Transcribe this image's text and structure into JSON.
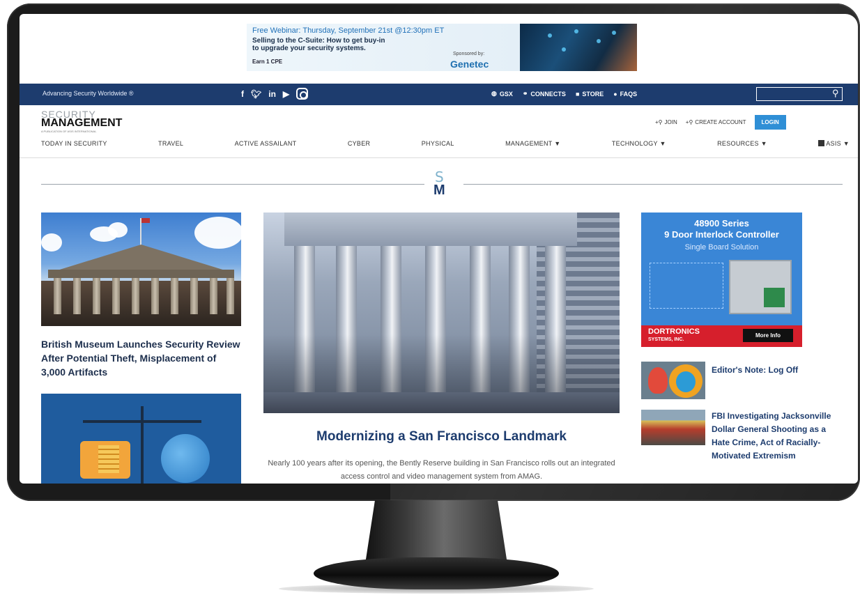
{
  "ad_banner": {
    "headline": "Free Webinar: Thursday, September 21st @12:30pm ET",
    "line1": "Selling to the C-Suite: How to get buy-in",
    "line2": "to upgrade your security systems.",
    "earn": "Earn 1 CPE",
    "sponsored_by": "Sponsored by:",
    "sponsor": "Genetec"
  },
  "topbar": {
    "tagline": "Advancing Security Worldwide ®",
    "social": [
      "f",
      "y",
      "in"
    ],
    "links": [
      {
        "icon": "globe-icon",
        "glyph": "◍",
        "label": "GSX"
      },
      {
        "icon": "people-icon",
        "glyph": "⚭",
        "label": "CONNECTS"
      },
      {
        "icon": "cart-icon",
        "glyph": "■",
        "label": "STORE"
      },
      {
        "icon": "help-icon",
        "glyph": "●",
        "label": "FAQS"
      }
    ],
    "search_icon": "search-icon"
  },
  "logo": {
    "top": "SECURITY",
    "main": "MANAGEMENT",
    "sub": "A PUBLICATION OF ASIS INTERNATIONAL"
  },
  "account": {
    "join": "JOIN",
    "create": "CREATE ACCOUNT",
    "login": "LOGIN"
  },
  "nav": {
    "items": [
      "TODAY IN SECURITY",
      "TRAVEL",
      "ACTIVE ASSAILANT",
      "CYBER",
      "PHYSICAL",
      "MANAGEMENT ▼",
      "TECHNOLOGY ▼",
      "RESOURCES ▼"
    ],
    "asis": "ASIS ▼"
  },
  "divider": {
    "s": "S",
    "m": "M"
  },
  "left": {
    "story_title": "British Museum Launches Security Review After Potential Theft, Misplacement of 3,000 Artifacts"
  },
  "hero": {
    "title": "Modernizing a San Francisco Landmark",
    "desc": "Nearly 100 years after its opening, the Bently Reserve building in San Francisco rolls out an integrated access control and video management system from AMAG."
  },
  "right": {
    "ad_series": "48900 Series",
    "ad_title": "9 Door Interlock Controller",
    "ad_sub": "Single Board Solution",
    "ad_brand": "DORTRONICS",
    "ad_brand2": "SYSTEMS, INC.",
    "ad_more": "More Info",
    "story1": "Editor's Note: Log Off",
    "story2": "FBI Investigating Jacksonville Dollar General Shooting as a Hate Crime, Act of Racially-Motivated Extremism"
  },
  "colors": {
    "navy": "#1d3c6e",
    "login_blue": "#2f8fd6",
    "ad_red": "#d61f2c"
  }
}
